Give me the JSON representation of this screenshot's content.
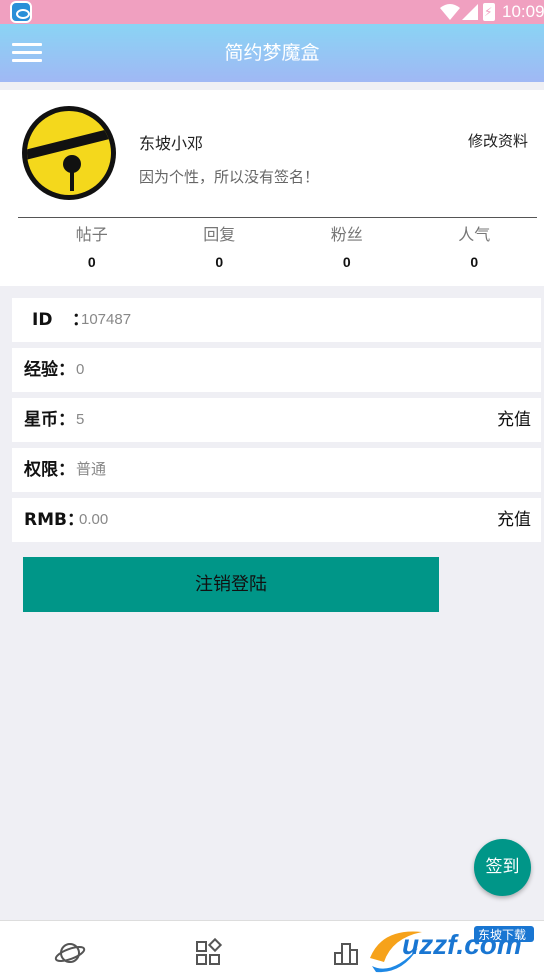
{
  "status_bar": {
    "time": "10:09"
  },
  "app_bar": {
    "title": "简约梦魔盒"
  },
  "profile": {
    "username": "东坡小邓",
    "signature": "因为个性，所以没有签名！",
    "edit_label": "修改资料",
    "stats": [
      {
        "label": "帖子",
        "value": "0"
      },
      {
        "label": "回复",
        "value": "0"
      },
      {
        "label": "粉丝",
        "value": "0"
      },
      {
        "label": "人气",
        "value": "0"
      }
    ]
  },
  "info": {
    "id": {
      "key": "ID",
      "colon": "：",
      "value": "107487"
    },
    "exp": {
      "key": "经验：",
      "value": "0"
    },
    "coins": {
      "key": "星币：",
      "value": "5",
      "action": "充值"
    },
    "permission": {
      "key": "权限：",
      "value": "普通"
    },
    "rmb": {
      "key": "RMB：",
      "value": "0.00",
      "action": "充值"
    }
  },
  "logout_label": "注销登陆",
  "signin_label": "签到",
  "bottom_nav": [
    {
      "icon": "planet-icon"
    },
    {
      "icon": "apps-grid-icon"
    },
    {
      "icon": "ranking-chart-icon"
    }
  ],
  "watermark": {
    "text": "uzzf.com",
    "brand": "东坡下载"
  }
}
